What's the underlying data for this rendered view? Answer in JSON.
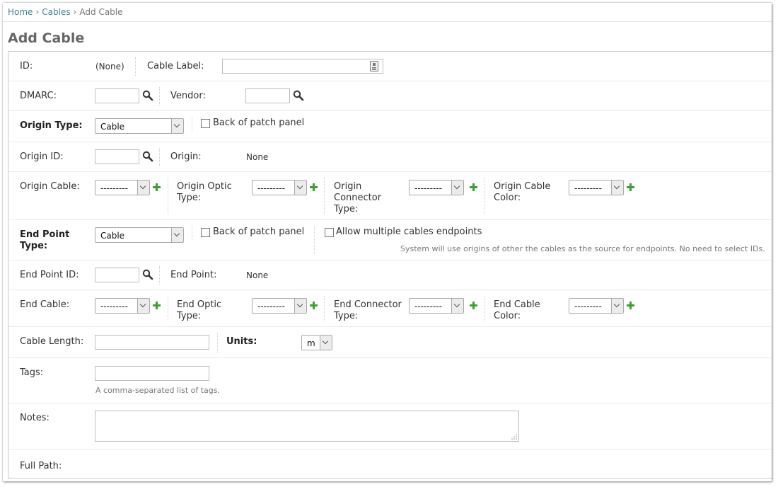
{
  "breadcrumb": {
    "home": "Home",
    "cables": "Cables",
    "current": "Add Cable",
    "separator": "›"
  },
  "page_title": "Add Cable",
  "fields": {
    "id": {
      "label": "ID:",
      "value": "(None)"
    },
    "cable_label": {
      "label": "Cable Label:",
      "value": ""
    },
    "dmarc": {
      "label": "DMARC:",
      "value": ""
    },
    "vendor": {
      "label": "Vendor:",
      "value": ""
    },
    "origin_type": {
      "label": "Origin Type:",
      "selected": "Cable"
    },
    "back_of_patch_panel_origin": {
      "label": "Back of patch panel",
      "checked": false
    },
    "origin_id": {
      "label": "Origin ID:",
      "value": ""
    },
    "origin": {
      "label": "Origin:",
      "value": "None"
    },
    "origin_cable": {
      "label": "Origin Cable:",
      "selected": "---------"
    },
    "origin_optic_type": {
      "label_line1": "Origin Optic",
      "label_line2": "Type:",
      "selected": "---------"
    },
    "origin_connector_type": {
      "label_line1": "Origin",
      "label_line2": "Connector",
      "label_line3": "Type:",
      "selected": "---------"
    },
    "origin_cable_color": {
      "label_line1": "Origin Cable",
      "label_line2": "Color:",
      "selected": "---------"
    },
    "end_point_type": {
      "label_line1": "End Point",
      "label_line2": "Type:",
      "selected": "Cable"
    },
    "back_of_patch_panel_end": {
      "label": "Back of patch panel",
      "checked": false
    },
    "allow_multiple": {
      "label": "Allow multiple cables endpoints",
      "checked": false,
      "help": "System will use origins of other the cables as the source for endpoints. No need to select IDs."
    },
    "end_point_id": {
      "label": "End Point ID:",
      "value": ""
    },
    "end_point": {
      "label": "End Point:",
      "value": "None"
    },
    "end_cable": {
      "label": "End Cable:",
      "selected": "---------"
    },
    "end_optic_type": {
      "label_line1": "End Optic",
      "label_line2": "Type:",
      "selected": "---------"
    },
    "end_connector_type": {
      "label_line1": "End Connector",
      "label_line2": "Type:",
      "selected": "---------"
    },
    "end_cable_color": {
      "label_line1": "End Cable",
      "label_line2": "Color:",
      "selected": "---------"
    },
    "cable_length": {
      "label": "Cable Length:",
      "value": ""
    },
    "units": {
      "label": "Units:",
      "selected": "m"
    },
    "tags": {
      "label": "Tags:",
      "value": "",
      "help": "A comma-separated list of tags."
    },
    "notes": {
      "label": "Notes:",
      "value": ""
    },
    "full_path": {
      "label": "Full Path:"
    }
  },
  "icons": {
    "lookup": "magnifier-icon",
    "add": "add-plus-icon",
    "cable_label_widget": "id-card-icon"
  },
  "colors": {
    "link": "#447e9b",
    "add_green": "#3aa02f",
    "title": "#666666"
  }
}
